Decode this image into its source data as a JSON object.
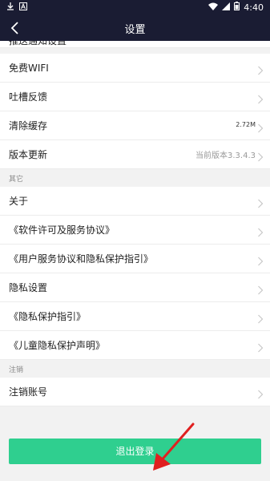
{
  "status_bar": {
    "time": "4:40",
    "left_icons": [
      "download-icon",
      "a-icon"
    ],
    "right_icons": [
      "wifi-icon",
      "signal-icon",
      "battery-icon"
    ]
  },
  "nav": {
    "title": "设置"
  },
  "list_top_cut_label": "推送通知设置",
  "items_group1": [
    {
      "label": "免费WIFI",
      "value": ""
    },
    {
      "label": "吐槽反馈",
      "value": ""
    },
    {
      "label": "清除缓存",
      "value": "2.72M"
    },
    {
      "label": "版本更新",
      "value": "当前版本3.3.4.3"
    }
  ],
  "section_other": "其它",
  "items_group2": [
    {
      "label": "关于"
    },
    {
      "label": "《软件许可及服务协议》"
    },
    {
      "label": "《用户服务协议和隐私保护指引》"
    },
    {
      "label": "隐私设置"
    },
    {
      "label": "《隐私保护指引》"
    },
    {
      "label": "《儿童隐私保护声明》"
    }
  ],
  "section_cancel": "注销",
  "items_group3": [
    {
      "label": "注销账号"
    }
  ],
  "logout_button": "退出登录",
  "colors": {
    "header": "#1a1c33",
    "accent": "#2fcf8f",
    "arrow": "#e02020"
  }
}
